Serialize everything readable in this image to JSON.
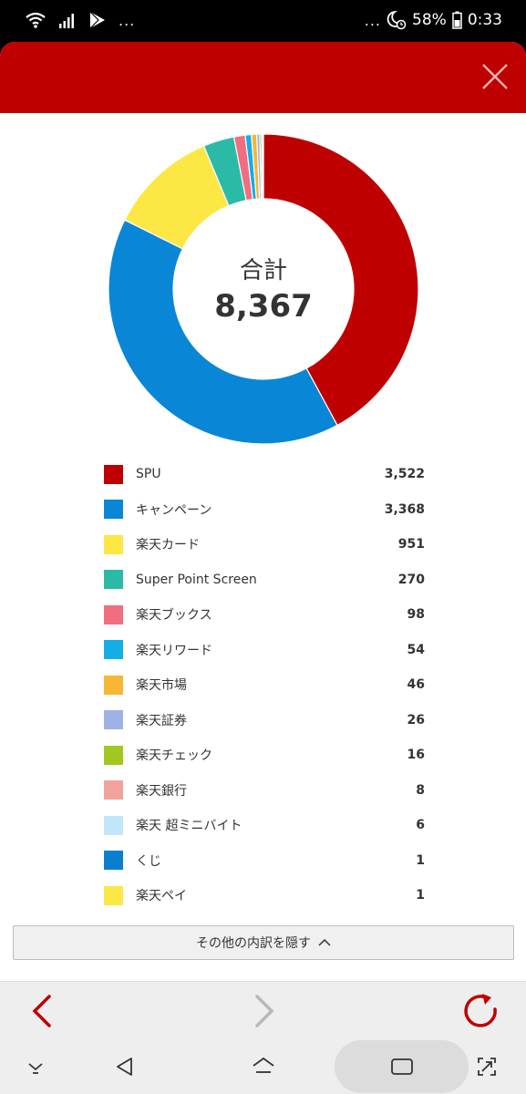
{
  "status": {
    "dots_left": "...",
    "dots_right": "...",
    "battery": "58%",
    "time": "0:33"
  },
  "icons": [
    "wifi-icon",
    "signal-icon",
    "play-store-icon",
    "alarm-moon-icon",
    "battery-icon",
    "close-icon",
    "back-arrow-icon",
    "forward-arrow-icon",
    "reload-icon",
    "chevron-up-icon",
    "nav-down-icon",
    "nav-back-icon",
    "nav-home-icon",
    "nav-recents-icon",
    "nav-expand-icon"
  ],
  "colors": {
    "brand": "#bf0000",
    "text": "#333333"
  },
  "chart_title": "合計",
  "chart_total": "8,367",
  "chart_data": {
    "type": "pie",
    "categories": [
      "SPU",
      "キャンペーン",
      "楽天カード",
      "Super Point Screen",
      "楽天ブックス",
      "楽天リワード",
      "楽天市場",
      "楽天証券",
      "楽天チェック",
      "楽天銀行",
      "楽天 超ミニバイト",
      "くじ",
      "楽天ペイ"
    ],
    "values": [
      3522,
      3368,
      951,
      270,
      98,
      54,
      46,
      26,
      16,
      8,
      6,
      1,
      1
    ],
    "labels": [
      "3,522",
      "3,368",
      "951",
      "270",
      "98",
      "54",
      "46",
      "26",
      "16",
      "8",
      "6",
      "1",
      "1"
    ],
    "colors": [
      "#bf0000",
      "#0a86d6",
      "#fde745",
      "#2bbaa5",
      "#f06e80",
      "#13aee6",
      "#f7b633",
      "#9fb2e6",
      "#a2c820",
      "#f2a29c",
      "#c2e6f8",
      "#0a7fcf",
      "#fde745"
    ]
  },
  "more_button": {
    "label": "その他の内訳を隠す"
  }
}
